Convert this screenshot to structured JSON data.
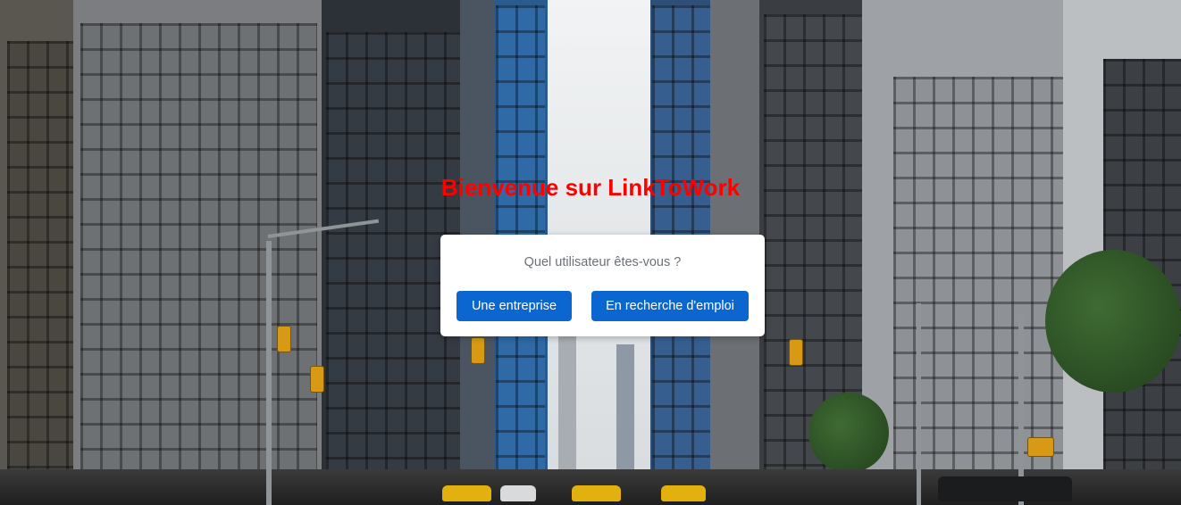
{
  "hero": {
    "title": "Bienvenue sur LinkToWork"
  },
  "chooser": {
    "question": "Quel utilisateur êtes-vous ?",
    "company_label": "Une entreprise",
    "jobseeker_label": "En recherche d'emploi"
  },
  "colors": {
    "title": "#ff0000",
    "button": "#0b67cf",
    "top_strip": "#0b3a78"
  }
}
